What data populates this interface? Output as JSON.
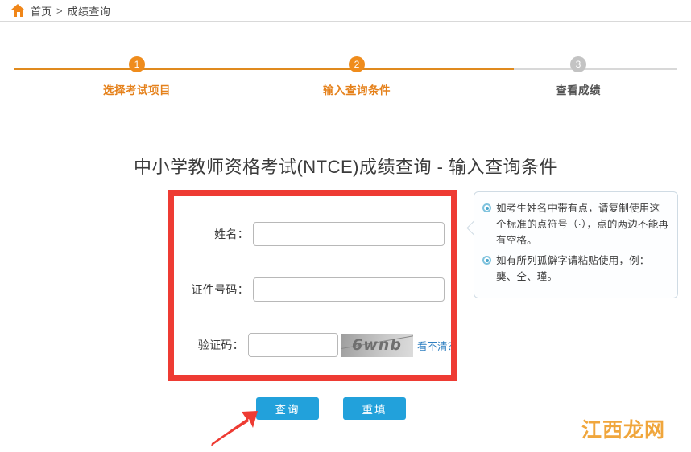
{
  "breadcrumb": {
    "home_icon": "home-icon",
    "home_label": "首页",
    "separator": ">",
    "current": "成绩查询"
  },
  "stepper": {
    "steps": [
      {
        "number": "1",
        "label": "选择考试项目",
        "state": "active"
      },
      {
        "number": "2",
        "label": "输入查询条件",
        "state": "active"
      },
      {
        "number": "3",
        "label": "查看成绩",
        "state": "inactive"
      }
    ],
    "active_color": "#ef8c1c",
    "inactive_color": "#c3c3c3",
    "track_done_color": "#e08a1e",
    "track_color": "#d8d8d8"
  },
  "page": {
    "title": "中小学教师资格考试(NTCE)成绩查询 - 输入查询条件"
  },
  "form": {
    "highlight_color": "#ee3b33",
    "fields": [
      {
        "label": "姓名：",
        "value": "",
        "placeholder": ""
      },
      {
        "label": "证件号码：",
        "value": "",
        "placeholder": ""
      },
      {
        "label": "验证码：",
        "value": "",
        "placeholder": ""
      }
    ],
    "captcha": {
      "text": "6wnb",
      "refresh_label": "看不清？"
    }
  },
  "info_panel": {
    "items": [
      "如考生姓名中带有点，请复制使用这个标准的点符号（·），点的两边不能再有空格。",
      "如有所列孤僻字请粘贴使用，例：龑、仝、瑾。"
    ],
    "border_color": "#cfdbe4",
    "bullet_color": "#4aa6cc"
  },
  "buttons": {
    "submit_label": "查询",
    "reset_label": "重填",
    "color": "#22a1db"
  },
  "annotation": {
    "arrow_color": "#ee3b33",
    "arrow_points_to": "查询"
  },
  "watermark": {
    "text": "江西龙网",
    "color": "#f0a63c"
  }
}
